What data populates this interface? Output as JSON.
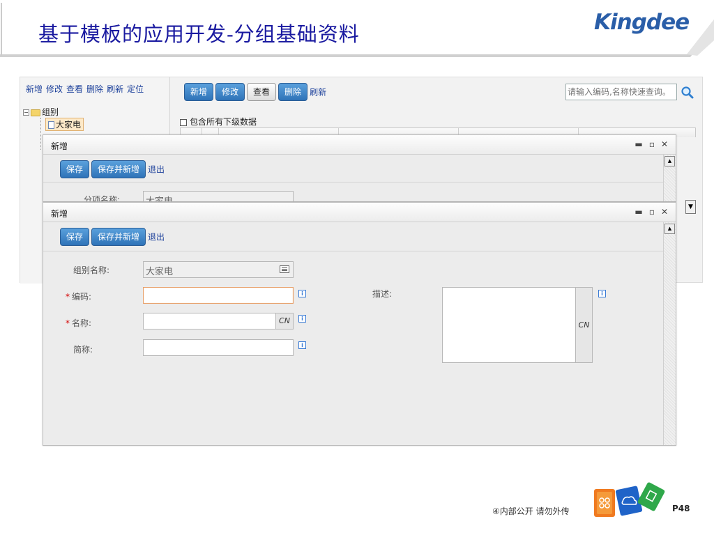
{
  "slide": {
    "title": "基于模板的应用开发-分组基础资料",
    "logo": "Kingdee",
    "footer_note": "④内部公开 请勿外传",
    "page_number": "P48"
  },
  "background_window": {
    "tree_toolbar": [
      "新增",
      "修改",
      "查看",
      "删除",
      "刷新",
      "定位"
    ],
    "tree_root": "组别",
    "tree_child": "大家电",
    "list_buttons": [
      "新增",
      "修改",
      "查看",
      "删除"
    ],
    "refresh_link": "刷新",
    "search_placeholder": "请输入编码,名称快速查询。",
    "include_sub_label": "包含所有下级数据"
  },
  "dialog_back": {
    "title": "新增",
    "save": "保存",
    "save_and_new": "保存并新增",
    "exit": "退出",
    "partial_label": "分项名称:",
    "partial_value": "大家电"
  },
  "dialog_front": {
    "title": "新增",
    "save": "保存",
    "save_and_new": "保存并新增",
    "exit": "退出",
    "group_name_label": "组别名称:",
    "group_name_value": "大家电",
    "code_label": "编码:",
    "code_value": "",
    "name_label": "名称:",
    "name_value": "",
    "short_name_label": "简称:",
    "short_name_value": "",
    "description_label": "描述:",
    "description_value": "",
    "multilang_label": "CN"
  },
  "icons": {
    "window_minimize": "minimize-icon",
    "window_maximize": "maximize-icon",
    "window_close": "close-icon",
    "search": "search-icon",
    "info": "info-icon",
    "picker": "list-picker-icon"
  },
  "colors": {
    "title_blue": "#1a1aa0",
    "logo_blue": "#2a5ea8",
    "button_blue": "#2f73b8",
    "required_red": "#d40000"
  }
}
